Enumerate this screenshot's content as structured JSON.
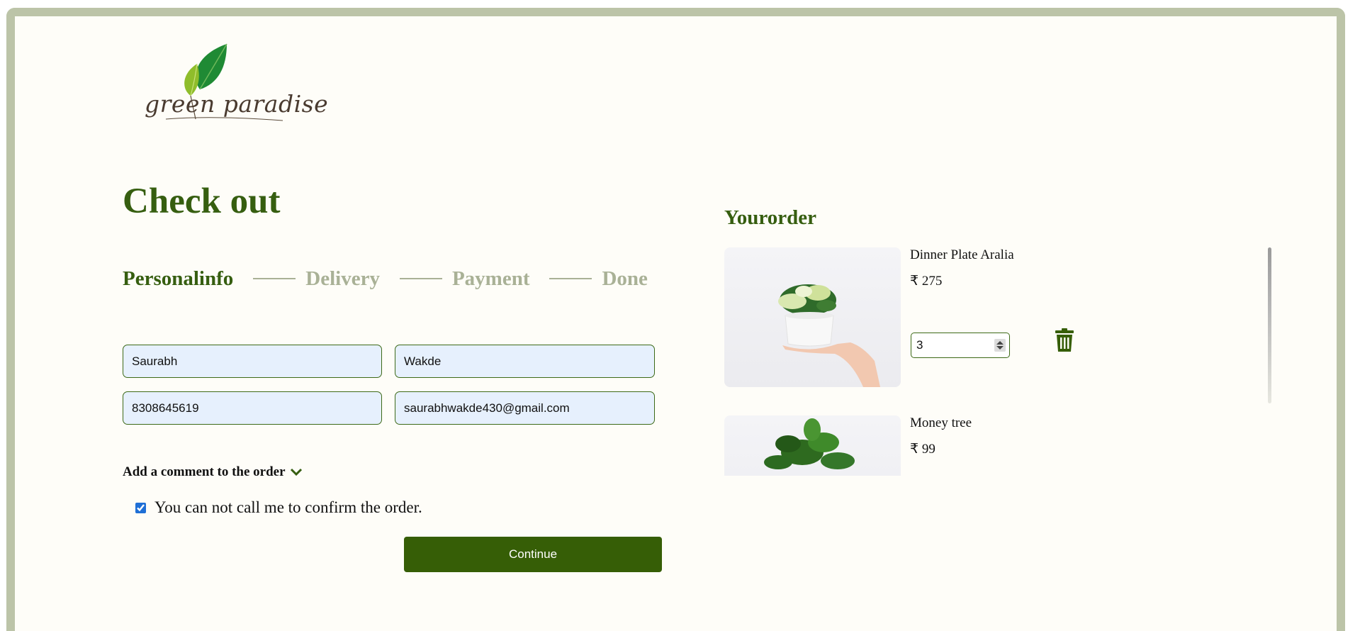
{
  "brand": {
    "logo_text": "green paradise",
    "accent_color": "#365e10",
    "leaf_colors": [
      "#1f8a34",
      "#8fbd2b"
    ]
  },
  "checkout": {
    "title": "Check out",
    "steps": [
      {
        "label": "Personalinfo",
        "active": true
      },
      {
        "label": "Delivery",
        "active": false
      },
      {
        "label": "Payment",
        "active": false
      },
      {
        "label": "Done",
        "active": false
      }
    ],
    "form": {
      "first_name": "Saurabh",
      "last_name": "Wakde",
      "phone": "8308645619",
      "email": "saurabhwakde430@gmail.com"
    },
    "comment_toggle": "Add a comment to the order",
    "confirm_checkbox": {
      "label": "You can not call me to confirm the order.",
      "checked": true
    },
    "continue_label": "Continue"
  },
  "order": {
    "title": "Yourorder",
    "items": [
      {
        "name": "Dinner Plate Aralia",
        "price": "₹ 275",
        "quantity": "3",
        "icon": "trash-icon"
      },
      {
        "name": "Money tree",
        "price": "₹ 99"
      }
    ]
  }
}
